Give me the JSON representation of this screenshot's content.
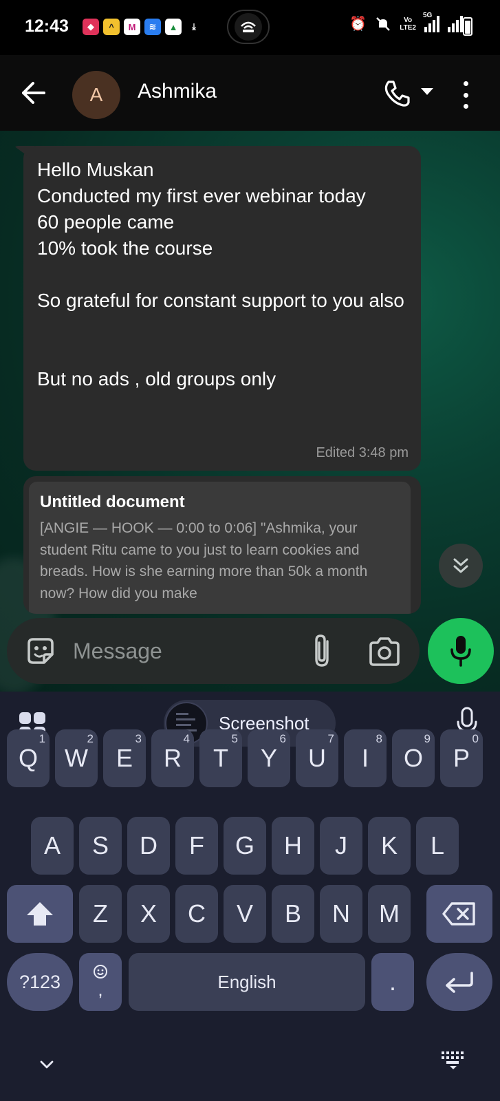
{
  "status_bar": {
    "time": "12:43",
    "network_label": "Vo LTE2",
    "network_label_top": "Vo",
    "network_label_bottom": "LTE2",
    "signal_label": "5G"
  },
  "header": {
    "avatar_letter": "A",
    "contact_name": "Ashmika",
    "colors": {
      "avatar_bg": "#4a3122",
      "avatar_text": "#f2c7a7"
    }
  },
  "messages": [
    {
      "text": "Hello Muskan\nConducted my first ever webinar today\n60 people came\n10% took the course\n\nSo grateful for constant support to you also\n\n\nBut no ads , old groups only",
      "meta": "Edited 3:48 pm"
    },
    {
      "doc_title": "Untitled document",
      "doc_preview": "[ANGIE — HOOK — 0:00 to 0:06] \"Ashmika, your student Ritu came to you just to learn cookies and breads. How is she earning more than 50k a month now? How did you make"
    }
  ],
  "composer": {
    "placeholder": "Message",
    "colors": {
      "mic_button": "#1dc15b"
    }
  },
  "keyboard": {
    "suggestion_label": "Screenshot",
    "rows": [
      [
        {
          "label": "Q",
          "hint": "1"
        },
        {
          "label": "W",
          "hint": "2"
        },
        {
          "label": "E",
          "hint": "3"
        },
        {
          "label": "R",
          "hint": "4"
        },
        {
          "label": "T",
          "hint": "5"
        },
        {
          "label": "Y",
          "hint": "6"
        },
        {
          "label": "U",
          "hint": "7"
        },
        {
          "label": "I",
          "hint": "8"
        },
        {
          "label": "O",
          "hint": "9"
        },
        {
          "label": "P",
          "hint": "0"
        }
      ],
      [
        {
          "label": "A"
        },
        {
          "label": "S"
        },
        {
          "label": "D"
        },
        {
          "label": "F"
        },
        {
          "label": "G"
        },
        {
          "label": "H"
        },
        {
          "label": "J"
        },
        {
          "label": "K"
        },
        {
          "label": "L"
        }
      ],
      [
        {
          "label": "Z"
        },
        {
          "label": "X"
        },
        {
          "label": "C"
        },
        {
          "label": "V"
        },
        {
          "label": "B"
        },
        {
          "label": "N"
        },
        {
          "label": "M"
        }
      ]
    ],
    "symbols_label": "?123",
    "comma_label": ",",
    "space_label": "English",
    "period_label": ".",
    "shift_icon": "shift-icon",
    "backspace_icon": "backspace-icon",
    "enter_icon": "enter-icon"
  }
}
